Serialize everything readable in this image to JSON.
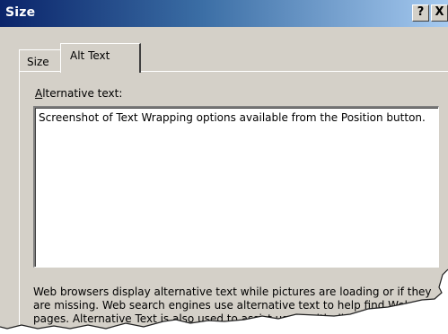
{
  "window": {
    "title": "Size",
    "help_label": "?",
    "close_label": "X"
  },
  "tabs": [
    {
      "label": "Size",
      "selected": false
    },
    {
      "label": "Alt Text",
      "selected": true
    }
  ],
  "alt_text": {
    "label_accel": "A",
    "label_rest": "lternative text:",
    "value": "Screenshot of Text Wrapping options available from the Position button."
  },
  "description": {
    "text_before": "Web browsers display alternative text while pictures are loading or if they are missing.  Web search engines use alternative text to help find Web pages.  Alternative Text is also used to ",
    "link_text": "assist users with disabilities",
    "text_after": "."
  },
  "colors": {
    "title_gradient_start": "#0a246a",
    "title_gradient_end": "#a6caf0",
    "dialog_face": "#d4d0c8"
  }
}
